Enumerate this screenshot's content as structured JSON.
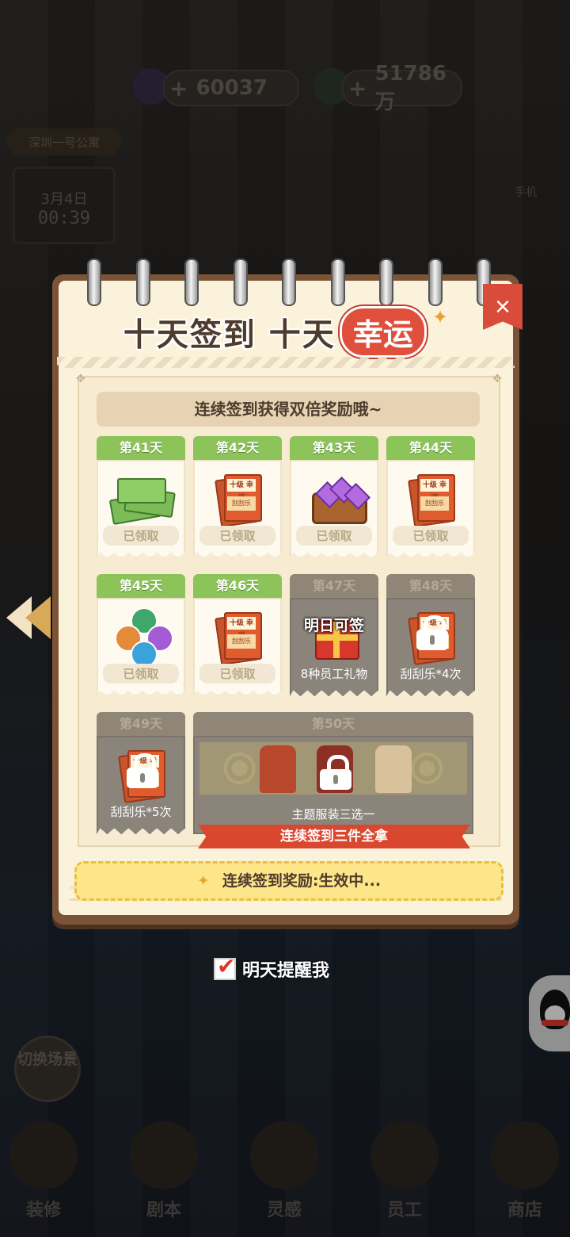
{
  "hud": {
    "diamonds": "60037",
    "money": "51786万",
    "location": "深圳一号公寓",
    "date": "3月4日",
    "time": "00:39",
    "phone_label": "手机"
  },
  "modal": {
    "title_main": "十天签到 十天",
    "title_highlight": "幸运",
    "close_label": "×",
    "banner": "连续签到获得双倍奖励哦~",
    "days": [
      {
        "day": "第41天",
        "label": "已领取",
        "state": "claimed",
        "item": "cash-stack-icon"
      },
      {
        "day": "第42天",
        "label": "已领取",
        "state": "claimed",
        "item": "scratch-ticket-icon"
      },
      {
        "day": "第43天",
        "label": "已领取",
        "state": "claimed",
        "item": "gem-chest-icon"
      },
      {
        "day": "第44天",
        "label": "已领取",
        "state": "claimed",
        "item": "scratch-ticket-icon"
      },
      {
        "day": "第45天",
        "label": "已领取",
        "state": "claimed",
        "item": "four-gems-icon"
      },
      {
        "day": "第46天",
        "label": "已领取",
        "state": "claimed",
        "item": "scratch-ticket-icon"
      },
      {
        "day": "第47天",
        "label": "8种员工礼物",
        "overlay": "明日可签",
        "state": "tomorrow",
        "item": "gift-box-icon"
      },
      {
        "day": "第48天",
        "label": "刮刮乐*4次",
        "state": "locked",
        "item": "scratch-ticket-icon"
      },
      {
        "day": "第49天",
        "label": "刮刮乐*5次",
        "state": "locked",
        "item": "scratch-ticket-icon"
      }
    ],
    "ticket_top": "十级 幸运",
    "ticket_bottom": "刮刮乐",
    "day50": {
      "day": "第50天",
      "label": "主题服装三选一",
      "ribbon": "连续签到三件全拿"
    },
    "status": "连续签到奖励:生效中..."
  },
  "remind": {
    "label": "明天提醒我",
    "checked": true
  },
  "left_side": {
    "switch_scene": "切换场景"
  },
  "nav": {
    "items": [
      "装修",
      "剧本",
      "灵感",
      "员工",
      "商店"
    ]
  },
  "colors": {
    "claimed_header": "#8cc45a",
    "locked_header": "#8f8678",
    "accent_red": "#d9472f",
    "status_yellow": "#fde58a"
  }
}
